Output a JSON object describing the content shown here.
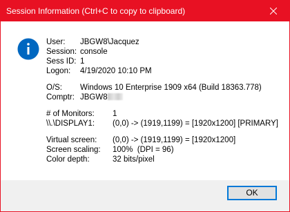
{
  "window": {
    "title": "Session Information (Ctrl+C to copy to clipboard)"
  },
  "icon": "info-icon",
  "session": {
    "user_label": "User:",
    "user_value": "JBGW8\\Jacquez",
    "session_label": "Session:",
    "session_value": "console",
    "sessid_label": "Sess ID:",
    "sessid_value": "1",
    "logon_label": "Logon:",
    "logon_value": "4/19/2020 10:10 PM"
  },
  "system": {
    "os_label": "O/S:",
    "os_value": "Windows 10 Enterprise 1909 x64 (Build 18363.778)",
    "comptr_label": "Comptr:",
    "comptr_value": "JBGW8"
  },
  "monitors": {
    "count_label": "# of Monitors:",
    "count_value": "1",
    "display_label": "\\\\.\\DISPLAY1:",
    "display_value": "(0,0) -> (1919,1199) = [1920x1200] [PRIMARY]"
  },
  "screen": {
    "virtual_label": "Virtual screen:",
    "virtual_value": "(0,0) -> (1919,1199) = [1920x1200]",
    "scaling_label": "Screen scaling:",
    "scaling_value": "100%  (DPI = 96)",
    "depth_label": "Color depth:",
    "depth_value": "32 bits/pixel"
  },
  "buttons": {
    "ok_label": "OK"
  },
  "colors": {
    "titlebar": "#e81123",
    "accent": "#0078d7",
    "icon": "#0067c0",
    "footer": "#f0f0f0"
  }
}
